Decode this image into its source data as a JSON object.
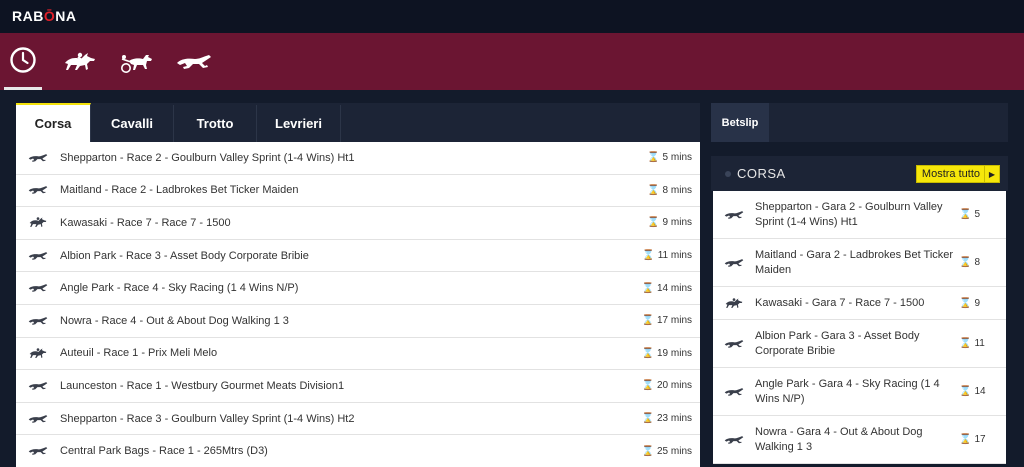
{
  "brand": {
    "logo_text_a": "RAB",
    "logo_text_accent": "Ō",
    "logo_text_b": "NA"
  },
  "nav": {
    "icons": [
      "clock-icon",
      "horse-racing-icon",
      "trotting-icon",
      "greyhound-icon"
    ],
    "active": 0
  },
  "tabs": [
    {
      "label": "Corsa"
    },
    {
      "label": "Cavalli"
    },
    {
      "label": "Trotto"
    },
    {
      "label": "Levrieri"
    }
  ],
  "races": [
    {
      "type": "greyhound",
      "name": "Shepparton - Race 2 - Goulburn Valley Sprint (1-4 Wins) Ht1",
      "time": "5 mins"
    },
    {
      "type": "greyhound",
      "name": "Maitland - Race 2 - Ladbrokes Bet Ticker Maiden",
      "time": "8 mins"
    },
    {
      "type": "horse",
      "name": "Kawasaki - Race 7 - Race 7 - 1500",
      "time": "9 mins"
    },
    {
      "type": "greyhound",
      "name": "Albion Park - Race 3 - Asset Body Corporate Bribie",
      "time": "11 mins"
    },
    {
      "type": "greyhound",
      "name": "Angle Park - Race 4 - Sky Racing (1 4 Wins N/P)",
      "time": "14 mins"
    },
    {
      "type": "greyhound",
      "name": "Nowra - Race 4 - Out & About Dog Walking 1 3",
      "time": "17 mins"
    },
    {
      "type": "horse",
      "name": "Auteuil - Race 1 - Prix Meli Melo",
      "time": "19 mins"
    },
    {
      "type": "greyhound",
      "name": "Launceston - Race 1 - Westbury Gourmet Meats Division1",
      "time": "20 mins"
    },
    {
      "type": "greyhound",
      "name": "Shepparton - Race 3 - Goulburn Valley Sprint (1-4 Wins) Ht2",
      "time": "23 mins"
    },
    {
      "type": "greyhound",
      "name": "Central Park Bags - Race 1 - 265Mtrs (D3)",
      "time": "25 mins"
    }
  ],
  "betslip": {
    "tab_label": "Betslip",
    "section_title": "CORSA",
    "show_all_label": "Mostra tutto",
    "items": [
      {
        "type": "greyhound",
        "name": "Shepparton - Gara 2 - Goulburn Valley Sprint (1-4 Wins) Ht1",
        "time": "5"
      },
      {
        "type": "greyhound",
        "name": "Maitland - Gara 2 - Ladbrokes Bet Ticker Maiden",
        "time": "8"
      },
      {
        "type": "horse",
        "name": "Kawasaki - Gara 7 - Race 7 - 1500",
        "time": "9"
      },
      {
        "type": "greyhound",
        "name": "Albion Park - Gara 3 - Asset Body Corporate Bribie",
        "time": "11"
      },
      {
        "type": "greyhound",
        "name": "Angle Park - Gara 4 - Sky Racing (1 4 Wins N/P)",
        "time": "14"
      },
      {
        "type": "greyhound",
        "name": "Nowra - Gara 4 - Out & About Dog Walking 1 3",
        "time": "17"
      }
    ]
  },
  "colors": {
    "brand_maroon": "#6b1532",
    "accent_yellow": "#f6e70a",
    "dark_bg": "#131b2b"
  }
}
